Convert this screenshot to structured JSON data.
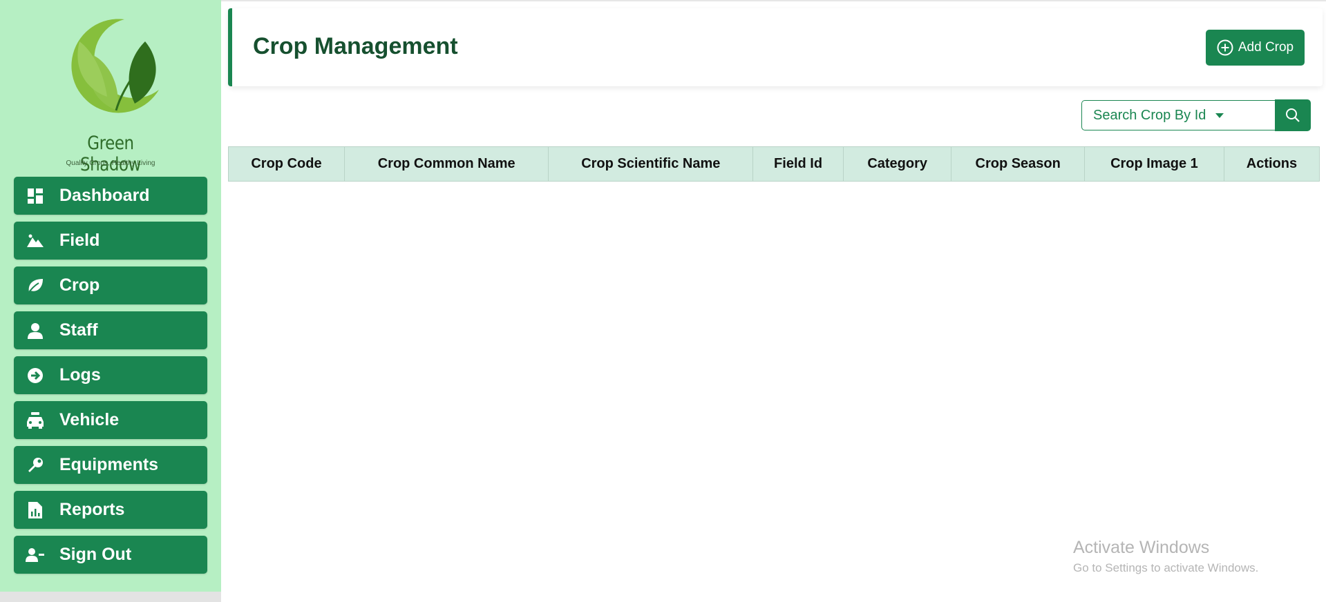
{
  "sidebar": {
    "brand_name": "Green Shadow",
    "brand_tagline": "Quality Crops, Healthy Living",
    "items": [
      {
        "label": "Dashboard",
        "icon": "dashboard-icon"
      },
      {
        "label": "Field",
        "icon": "landscape-icon"
      },
      {
        "label": "Crop",
        "icon": "leaf-icon"
      },
      {
        "label": "Staff",
        "icon": "person-icon"
      },
      {
        "label": "Logs",
        "icon": "arrow-circle-icon"
      },
      {
        "label": "Vehicle",
        "icon": "car-icon"
      },
      {
        "label": "Equipments",
        "icon": "wrench-icon"
      },
      {
        "label": "Reports",
        "icon": "report-icon"
      },
      {
        "label": "Sign Out",
        "icon": "user-minus-icon"
      }
    ]
  },
  "header": {
    "title": "Crop Management",
    "add_button_label": "Add Crop"
  },
  "search": {
    "select_label": "Search Crop By Id"
  },
  "table": {
    "columns": [
      "Crop Code",
      "Crop Common Name",
      "Crop Scientific Name",
      "Field Id",
      "Category",
      "Crop Season",
      "Crop Image 1",
      "Actions"
    ],
    "rows": []
  },
  "watermark": {
    "title": "Activate Windows",
    "subtitle": "Go to Settings to activate Windows."
  },
  "colors": {
    "accent": "#1a8651",
    "sidebar_bg": "#b6efc3",
    "title": "#16502f",
    "table_header_bg": "#d2ebe0"
  }
}
